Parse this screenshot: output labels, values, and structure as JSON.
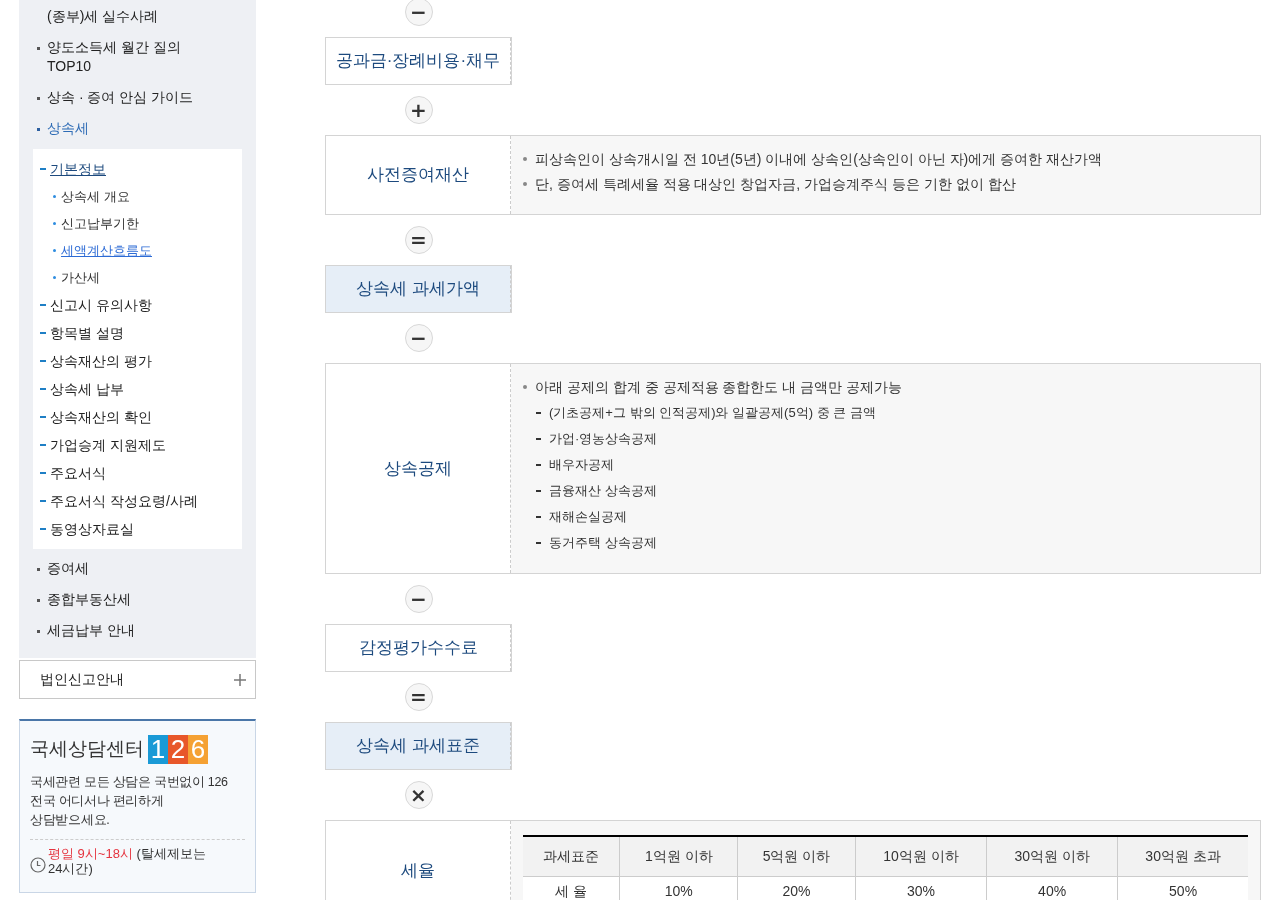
{
  "sidebar": {
    "items": [
      {
        "label": "(종부)세 실수사례",
        "kind": "continued",
        "selected": false
      },
      {
        "label": "양도소득세 월간 질의\nTOP10",
        "kind": "item",
        "selected": false
      },
      {
        "label": "상속 · 증여 안심 가이드",
        "kind": "item",
        "selected": false
      },
      {
        "label": "상속세",
        "kind": "item",
        "selected": true,
        "children": [
          {
            "label": "기본정보",
            "selected": true,
            "children": [
              {
                "label": "상속세 개요",
                "selected": false
              },
              {
                "label": "신고납부기한",
                "selected": false
              },
              {
                "label": "세액계산흐름도",
                "selected": true
              },
              {
                "label": "가산세",
                "selected": false
              }
            ]
          },
          {
            "label": "신고시 유의사항",
            "selected": false
          },
          {
            "label": "항목별 설명",
            "selected": false
          },
          {
            "label": "상속재산의 평가",
            "selected": false
          },
          {
            "label": "상속세 납부",
            "selected": false
          },
          {
            "label": "상속재산의 확인",
            "selected": false
          },
          {
            "label": "가업승계 지원제도",
            "selected": false
          },
          {
            "label": "주요서식",
            "selected": false
          },
          {
            "label": "주요서식 작성요령/사례",
            "selected": false
          },
          {
            "label": "동영상자료실",
            "selected": false
          }
        ]
      },
      {
        "label": "증여세",
        "kind": "item",
        "selected": false
      },
      {
        "label": "종합부동산세",
        "kind": "item",
        "selected": false
      },
      {
        "label": "세금납부 안내",
        "kind": "item",
        "selected": false
      }
    ],
    "section": {
      "label": "법인신고안내",
      "expanded": false
    }
  },
  "call_center": {
    "title": "국세상담센터",
    "logo_digits": [
      {
        "text": "1",
        "color": "#1a9ad6"
      },
      {
        "text": "2",
        "color": "#e8572a"
      },
      {
        "text": "6",
        "color": "#f5a133"
      }
    ],
    "description": "국세관련 모든 상담은 국번없이 126\n전국 어디서나 편리하게 상담받으세요.",
    "hours": "평일 9시~18시",
    "hours_note": "(탈세제보는 24시간)"
  },
  "flow": [
    {
      "kind": "operator",
      "symbol": "−"
    },
    {
      "kind": "box",
      "label": "공과금·장례비용·채무",
      "highlighted": false
    },
    {
      "kind": "operator",
      "symbol": "+"
    },
    {
      "kind": "box",
      "label": "사전증여재산",
      "highlighted": false,
      "bullets": [
        {
          "text": "피상속인이 상속개시일 전 10년(5년) 이내에 상속인(상속인이 아닌 자)에게 증여한 재산가액"
        },
        {
          "text": "단, 증여세 특례세율 적용 대상인 창업자금, 가업승계주식 등은 기한 없이 합산"
        }
      ]
    },
    {
      "kind": "operator",
      "symbol": "="
    },
    {
      "kind": "box",
      "label": "상속세 과세가액",
      "highlighted": true
    },
    {
      "kind": "operator",
      "symbol": "−"
    },
    {
      "kind": "box",
      "label": "상속공제",
      "highlighted": false,
      "bullets": [
        {
          "text": "아래 공제의 합계 중 공제적용 종합한도 내 금액만 공제가능",
          "children": [
            "(기초공제+그 밖의 인적공제)와 일괄공제(5억) 중 큰 금액",
            "가업·영농상속공제",
            "배우자공제",
            "금융재산 상속공제",
            "재해손실공제",
            "동거주택 상속공제"
          ]
        }
      ]
    },
    {
      "kind": "operator",
      "symbol": "−"
    },
    {
      "kind": "box",
      "label": "감정평가수수료",
      "highlighted": false
    },
    {
      "kind": "operator",
      "symbol": "="
    },
    {
      "kind": "box",
      "label": "상속세 과세표준",
      "highlighted": true
    },
    {
      "kind": "operator",
      "symbol": "×"
    },
    {
      "kind": "box",
      "label": "세율",
      "highlighted": false,
      "table": {
        "columns": [
          "과세표준",
          "1억원 이하",
          "5억원 이하",
          "10억원 이하",
          "30억원 이하",
          "30억원 초과"
        ],
        "rows": [
          [
            "세 율",
            "10%",
            "20%",
            "30%",
            "40%",
            "50%"
          ]
        ]
      }
    }
  ]
}
